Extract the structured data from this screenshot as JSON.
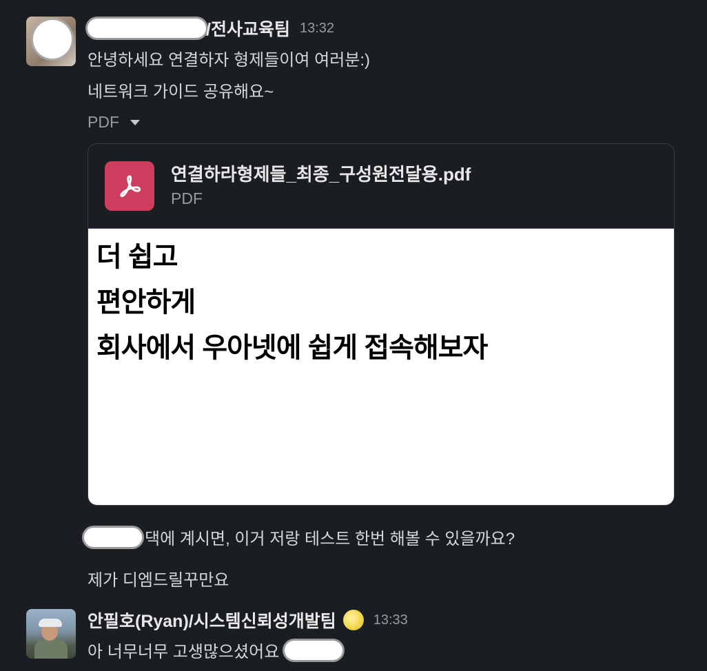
{
  "messages": [
    {
      "sender_suffix": "/전사교육팀",
      "time": "13:32",
      "lines": [
        "안녕하세요 연결하자 형제들이여 여러분:)",
        "네트워크 가이드 공유해요~"
      ],
      "attachment_toggle": "PDF",
      "file": {
        "name": "연결하라형제들_최종_구성원전달용.pdf",
        "type": "PDF",
        "preview_lines": [
          "더 쉽고",
          "편안하게",
          "회사에서 우아넷에 쉽게 접속해보자"
        ]
      }
    },
    {
      "line1_suffix": "댁에 계시면, 이거 저랑 테스트 한번 해볼 수 있을까요?",
      "line2": "제가 디엠드릴꾸만요"
    },
    {
      "sender": "안필호(Ryan)/시스템신뢰성개발팀",
      "time": "13:33",
      "text": "아 너무너무 고생많으셨어요",
      "status_emoji": "full-moon-emoji"
    }
  ]
}
